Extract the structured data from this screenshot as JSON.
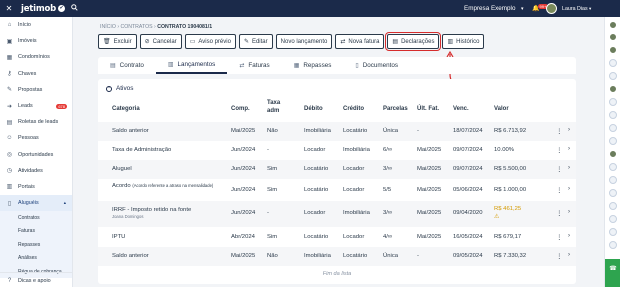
{
  "topbar": {
    "close": "✕",
    "logo": "jetimob",
    "logo_mark": "✔",
    "search_icon": "search-icon",
    "company": "Empresa Exemplo",
    "notifications": "99+",
    "user": "Laura Dias"
  },
  "sidebar": {
    "items": [
      {
        "label": "Início",
        "icon": "home-icon"
      },
      {
        "label": "Imóveis",
        "icon": "building-icon"
      },
      {
        "label": "Condomínios",
        "icon": "condo-icon"
      },
      {
        "label": "Chaves",
        "icon": "key-icon"
      },
      {
        "label": "Propostas",
        "icon": "proposal-icon"
      },
      {
        "label": "Leads",
        "icon": "leads-icon",
        "count": "678"
      },
      {
        "label": "Roletas de leads",
        "icon": "roulette-icon"
      },
      {
        "label": "Pessoas",
        "icon": "people-icon"
      },
      {
        "label": "Oportunidades",
        "icon": "opportunity-icon"
      },
      {
        "label": "Atividades",
        "icon": "activity-icon"
      },
      {
        "label": "Portais",
        "icon": "portal-icon"
      },
      {
        "label": "Aluguéis",
        "icon": "rent-icon",
        "active": true
      }
    ],
    "sub_items": [
      "Contratos",
      "Faturas",
      "Repasses",
      "Análises",
      "Régua de cobrança"
    ],
    "bottom": "Dicas e apoio"
  },
  "breadcrumb": {
    "home": "INÍCIO",
    "section": "CONTRATOS",
    "current": "CONTRATO 1904081/1"
  },
  "toolbar": {
    "excluir": "Excluir",
    "cancelar": "Cancelar",
    "aviso": "Aviso prévio",
    "editar": "Editar",
    "novo_lancamento": "Novo lançamento",
    "nova_fatura": "Nova fatura",
    "declaracoes": "Declarações",
    "historico": "Histórico"
  },
  "tabs": {
    "contrato": "Contrato",
    "lancamentos": "Lançamentos",
    "faturas": "Faturas",
    "repasses": "Repasses",
    "documentos": "Documentos"
  },
  "section_title": "Ativos",
  "table": {
    "headers": {
      "categoria": "Categoria",
      "comp": "Comp.",
      "taxa_adm_1": "Taxa",
      "taxa_adm_2": "adm",
      "debito": "Débito",
      "credito": "Crédito",
      "parcelas": "Parcelas",
      "ult_fat": "Últ. Fat.",
      "venc": "Venc.",
      "valor": "Valor"
    },
    "rows": [
      {
        "categoria": "Saldo anterior",
        "sub": "",
        "comp": "Mai/2025",
        "taxa": "Não",
        "debito": "Imobiliária",
        "credito": "Locatário",
        "parcelas": "Única",
        "ult": "-",
        "venc": "18/07/2024",
        "valor": "R$ 6.713,92",
        "warn": false
      },
      {
        "categoria": "Taxa de Administração",
        "sub": "",
        "comp": "Jun/2024",
        "taxa": "-",
        "debito": "Locador",
        "credito": "Imobiliária",
        "parcelas": "6/∞",
        "ult": "Mai/2025",
        "venc": "09/07/2024",
        "valor": "10.00%",
        "warn": false
      },
      {
        "categoria": "Aluguel",
        "sub": "",
        "comp": "Jun/2024",
        "taxa": "Sim",
        "debito": "Locatário",
        "credito": "Locador",
        "parcelas": "3/∞",
        "ult": "Mai/2025",
        "venc": "09/07/2024",
        "valor": "R$ 5.500,00",
        "warn": false
      },
      {
        "categoria": "Acordo",
        "cat_note": "(Acordo referente a atraso na mensalidade)",
        "sub": "",
        "comp": "Jun/2024",
        "taxa": "Sim",
        "debito": "Locatário",
        "credito": "Locador",
        "parcelas": "5/5",
        "ult": "Mai/2025",
        "venc": "05/06/2024",
        "valor": "R$ 1.000,00",
        "warn": false
      },
      {
        "categoria": "IRRF - Imposto retido na fonte",
        "sub": "Joana Domingos",
        "comp": "Jun/2024",
        "taxa": "-",
        "debito": "Locador",
        "credito": "Imobiliária",
        "parcelas": "3/∞",
        "ult": "Mai/2025",
        "venc": "09/04/2020",
        "valor": "R$ 461,25",
        "warn": true,
        "warn_icon": "⚠"
      },
      {
        "categoria": "IPTU",
        "sub": "",
        "comp": "Abr/2024",
        "taxa": "Sim",
        "debito": "Locatário",
        "credito": "Locador",
        "parcelas": "4/∞",
        "ult": "Mai/2025",
        "venc": "16/05/2024",
        "valor": "R$ 679,17",
        "warn": false
      },
      {
        "categoria": "Saldo anterior",
        "sub": "",
        "comp": "Mai/2025",
        "taxa": "Não",
        "debito": "Imobiliária",
        "credito": "Locatário",
        "parcelas": "Única",
        "ult": "-",
        "venc": "09/05/2024",
        "valor": "R$ 7.330,32",
        "warn": false
      }
    ],
    "end_text": "Fim da lista"
  },
  "colors": {
    "primary": "#1b2a4a",
    "highlight": "#d62c2c",
    "warning": "#d49a00",
    "badge": "#e53935"
  }
}
